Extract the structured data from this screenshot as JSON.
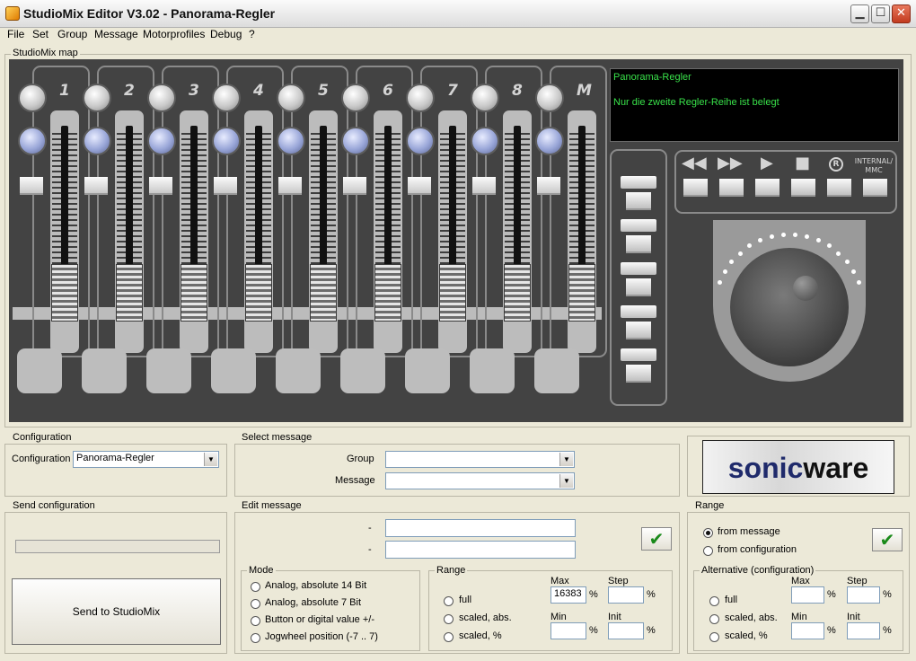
{
  "window": {
    "title": "StudioMix Editor V3.02 - Panorama-Regler"
  },
  "menu": [
    "File",
    "Set",
    "Group",
    "Message",
    "Motorprofiles",
    "Debug",
    "?"
  ],
  "map": {
    "label": "StudioMix map",
    "channels": [
      "1",
      "2",
      "3",
      "4",
      "5",
      "6",
      "7",
      "8",
      "M"
    ],
    "lcd": {
      "line1": "Panorama-Regler",
      "line2": "Nur die zweite Regler-Reihe ist belegt"
    },
    "transport": {
      "rec_symbol": "R",
      "internal_label": "INTERNAL/",
      "mmc_label": "MMC"
    }
  },
  "configuration": {
    "group_label": "Configuration",
    "field_label": "Configuration",
    "value": "Panorama-Regler"
  },
  "select_message": {
    "group_label": "Select message",
    "group_field_label": "Group",
    "group_value": "",
    "message_field_label": "Message",
    "message_value": ""
  },
  "logo": {
    "text_sonic": "sonic",
    "text_ware": "ware"
  },
  "send_configuration": {
    "group_label": "Send configuration",
    "button_label": "Send to StudioMix"
  },
  "edit_message": {
    "group_label": "Edit message",
    "row1_label": "-",
    "row1_value": "",
    "row2_label": "-",
    "row2_value": "",
    "mode": {
      "group_label": "Mode",
      "options": [
        "Analog, absolute 14 Bit",
        "Analog, absolute 7 Bit",
        "Button or digital value +/-",
        "Jogwheel position (-7 .. 7)"
      ]
    },
    "range": {
      "group_label": "Range",
      "options": [
        "full",
        "scaled, abs.",
        "scaled, %"
      ],
      "max_label": "Max",
      "max_value": "16383",
      "step_label": "Step",
      "step_value": "",
      "min_label": "Min",
      "min_value": "",
      "init_label": "Init",
      "init_value": "",
      "percent": "%"
    }
  },
  "range_panel": {
    "group_label": "Range",
    "options": [
      "from message",
      "from configuration"
    ],
    "selected": "from message",
    "alternative": {
      "group_label": "Alternative (configuration)",
      "options": [
        "full",
        "scaled, abs.",
        "scaled, %"
      ],
      "max_label": "Max",
      "max_value": "",
      "step_label": "Step",
      "step_value": "",
      "min_label": "Min",
      "min_value": "",
      "init_label": "Init",
      "init_value": "",
      "percent": "%"
    }
  },
  "colors": {
    "lcd_text": "#39e24a",
    "mixer_bg": "#434343",
    "ok_check": "#1a8a1a",
    "logo_blue": "#1f2a6b"
  }
}
